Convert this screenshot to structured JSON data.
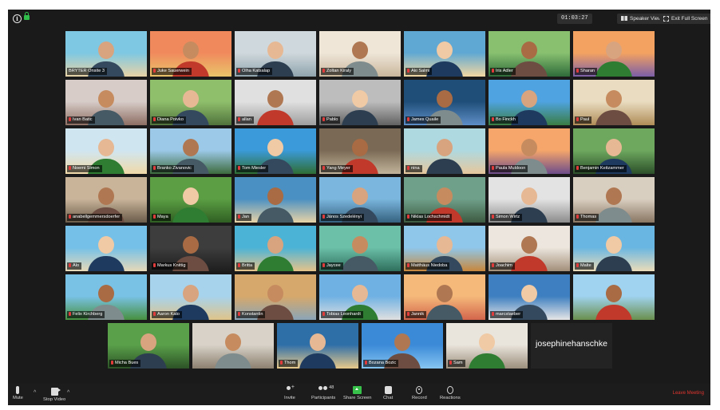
{
  "top_bar": {
    "timer": "01:03:27",
    "speaker_view": "Speaker View",
    "exit_fullscreen": "Exit Full Screen"
  },
  "participants": [
    {
      "name": "BRYTER Onsite 3",
      "active": true
    },
    {
      "name": "Juke Sauerwein"
    },
    {
      "name": "Olha Katsalap"
    },
    {
      "name": "Zoltan Kiraly"
    },
    {
      "name": "Aki Salmi"
    },
    {
      "name": "Iris Adler"
    },
    {
      "name": "Sharan"
    },
    {
      "name": "Ivan Batic"
    },
    {
      "name": "Diana Poivko"
    },
    {
      "name": "allan"
    },
    {
      "name": "Pablo"
    },
    {
      "name": "James Quaile"
    },
    {
      "name": "Bo Finckh"
    },
    {
      "name": "Paul"
    },
    {
      "name": "Noemi Simon"
    },
    {
      "name": "Branko Zivanovic"
    },
    {
      "name": "Tom Miesler"
    },
    {
      "name": "Yang Meyer"
    },
    {
      "name": "nina"
    },
    {
      "name": "Paula Muldoon"
    },
    {
      "name": "Benjamin Keitzammer"
    },
    {
      "name": "anabellgemmersdoerfer"
    },
    {
      "name": "Maya"
    },
    {
      "name": "Jan"
    },
    {
      "name": "János Szedelényi"
    },
    {
      "name": "Niklas Lochschmidt"
    },
    {
      "name": "Simon Wirtz"
    },
    {
      "name": "Thomas"
    },
    {
      "name": "Alo"
    },
    {
      "name": "Markus Knittig"
    },
    {
      "name": "Britta"
    },
    {
      "name": "Jaycee"
    },
    {
      "name": "Matthäus Niedoba"
    },
    {
      "name": "Joachim"
    },
    {
      "name": "Malte"
    },
    {
      "name": "Felix Kirchberg"
    },
    {
      "name": "Aaron Kato"
    },
    {
      "name": "Konstantin"
    },
    {
      "name": "Tobias Leonhardt"
    },
    {
      "name": "Jannik"
    },
    {
      "name": "marcstaeber"
    },
    {
      "name": ""
    },
    {
      "name": "Micha Bues"
    },
    {
      "name": ""
    },
    {
      "name": "Thom"
    },
    {
      "name": "Bozana Bozic"
    },
    {
      "name": "Sam"
    },
    {
      "name": "josephinehanschke",
      "video_off": true
    }
  ],
  "toolbar": {
    "mute": "Mute",
    "stop_video": "Stop Video",
    "invite": "Invite",
    "participants": "Participants",
    "participants_count": "48",
    "share_screen": "Share Screen",
    "chat": "Chat",
    "record": "Record",
    "reactions": "Reactions",
    "leave": "Leave Meeting"
  },
  "colors": {
    "active_speaker_border": "#e7e43a",
    "share_green": "#37c14a",
    "leave_red": "#e0352f",
    "muted_red": "#e23b3b"
  }
}
